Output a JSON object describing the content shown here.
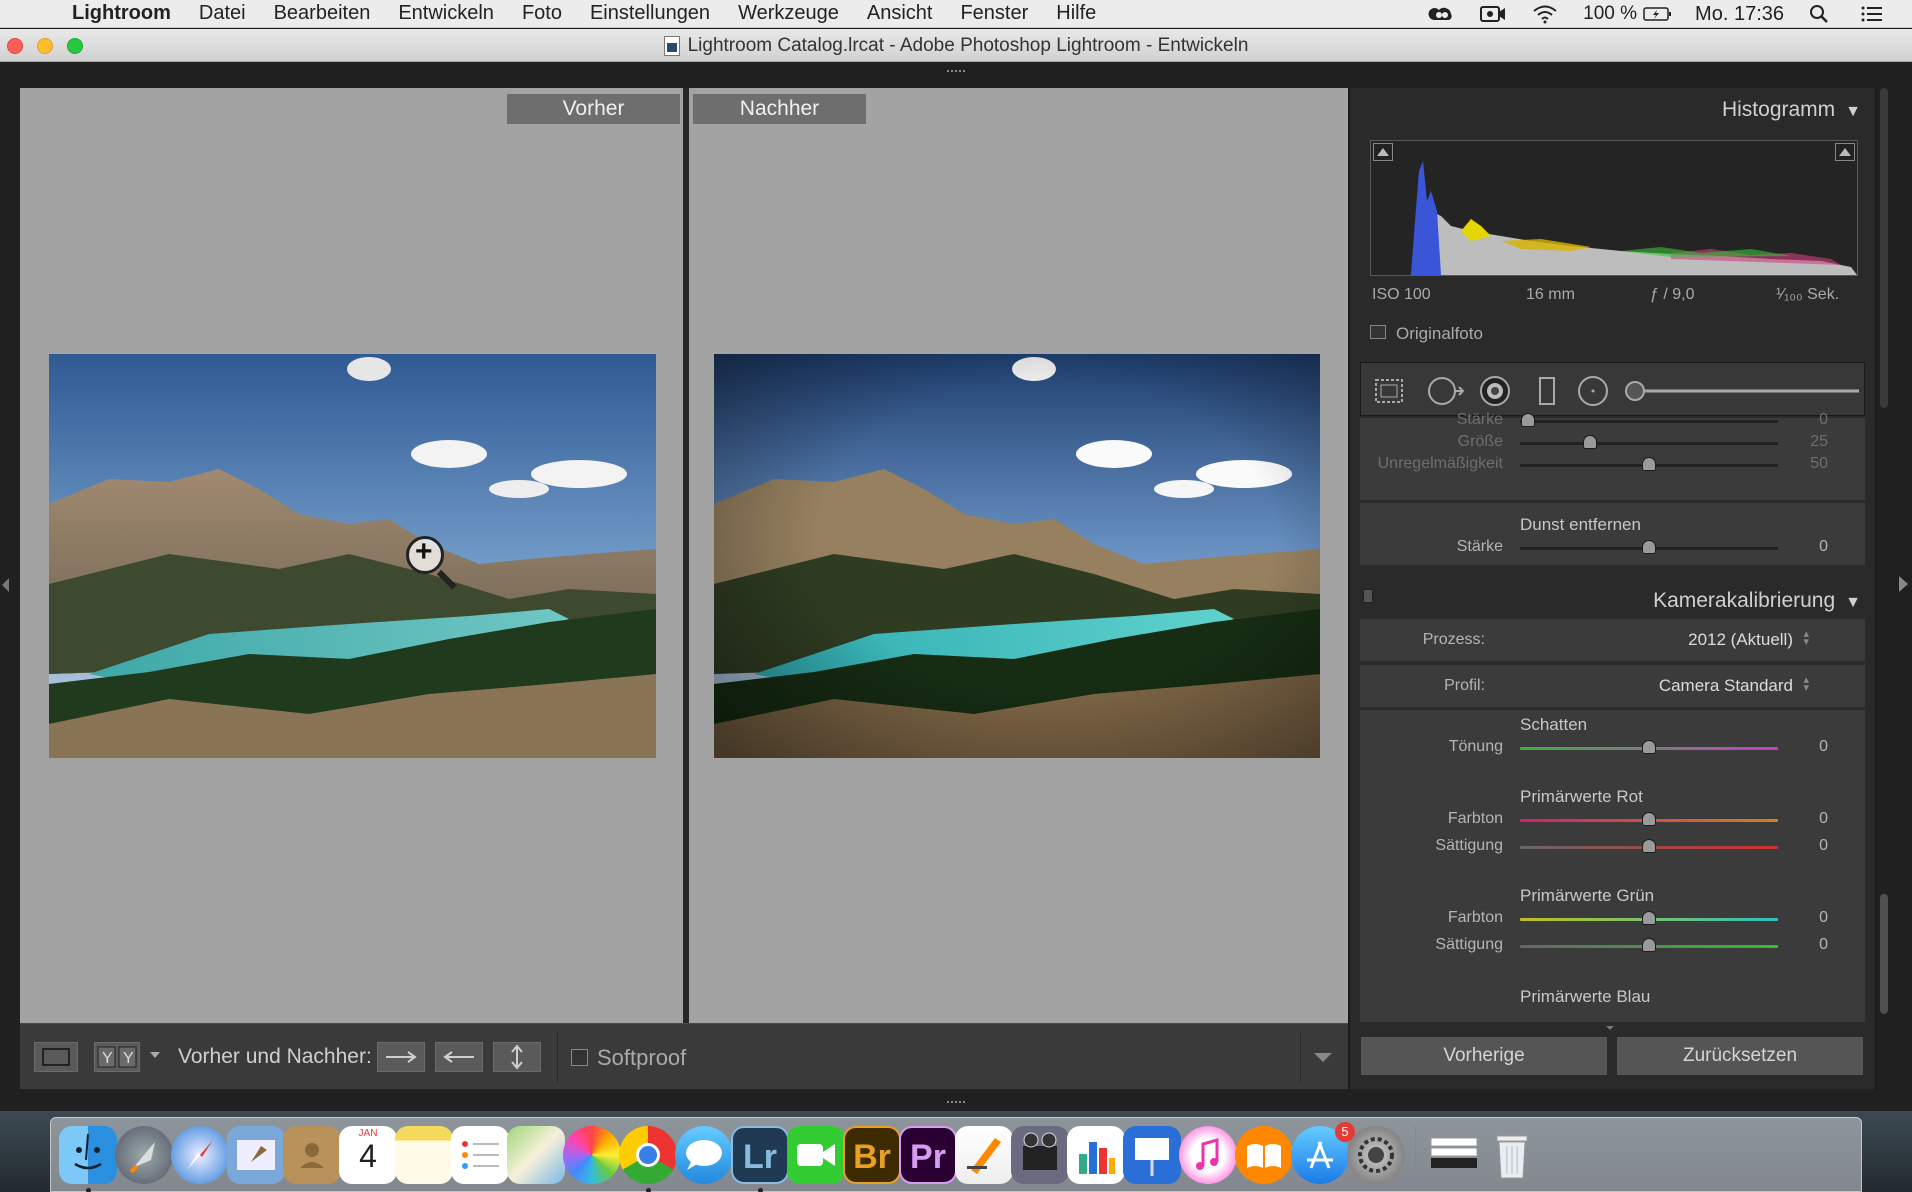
{
  "menubar": {
    "app_name": "Lightroom",
    "menus": [
      "Datei",
      "Bearbeiten",
      "Entwickeln",
      "Foto",
      "Einstellungen",
      "Werkzeuge",
      "Ansicht",
      "Fenster",
      "Hilfe"
    ],
    "battery": "100 %",
    "clock": "Mo. 17:36"
  },
  "window": {
    "title": "Lightroom Catalog.lrcat - Adobe Photoshop Lightroom - Entwickeln"
  },
  "viewer": {
    "before_label": "Vorher",
    "after_label": "Nachher"
  },
  "toolbar": {
    "compare_label": "Vorher und Nachher:",
    "softproof_label": "Softproof"
  },
  "panel": {
    "histogram_title": "Histogramm",
    "iso": "ISO 100",
    "focal": "16 mm",
    "aperture": "ƒ / 9,0",
    "shutter": "¹⁄₁₀₀ Sek.",
    "original_label": "Originalfoto",
    "vignette_rows": [
      {
        "label": "Stärke",
        "value": "0",
        "pos": 0.03
      },
      {
        "label": "Größe",
        "value": "25",
        "pos": 0.27
      },
      {
        "label": "Unregelmäßigkeit",
        "value": "50",
        "pos": 0.5
      }
    ],
    "dehaze": {
      "title": "Dunst entfernen",
      "label": "Stärke",
      "value": "0",
      "pos": 0.5
    },
    "calibration_title": "Kamerakalibrierung",
    "process_label": "Prozess:",
    "process_value": "2012 (Aktuell)",
    "profile_label": "Profil:",
    "profile_value": "Camera Standard",
    "shadows": {
      "title": "Schatten",
      "label": "Tönung",
      "value": "0"
    },
    "red": {
      "title": "Primärwerte Rot",
      "hue_label": "Farbton",
      "hue_value": "0",
      "sat_label": "Sättigung",
      "sat_value": "0"
    },
    "green": {
      "title": "Primärwerte Grün",
      "hue_label": "Farbton",
      "hue_value": "0",
      "sat_label": "Sättigung",
      "sat_value": "0"
    },
    "blue_title": "Primärwerte Blau",
    "prev_button": "Vorherige",
    "reset_button": "Zurücksetzen"
  },
  "dock": {
    "calendar_month": "JAN",
    "calendar_day": "4",
    "lr_label": "Lr",
    "br_label": "Br",
    "pr_label": "Pr",
    "appstore_badge": "5"
  },
  "colors": {
    "panel_bg": "#3b3b3b",
    "viewer_bg": "#a3a3a3",
    "lr_badge": "#1f3a52",
    "br_badge": "#3d2a00",
    "pr_badge": "#2a0033"
  }
}
